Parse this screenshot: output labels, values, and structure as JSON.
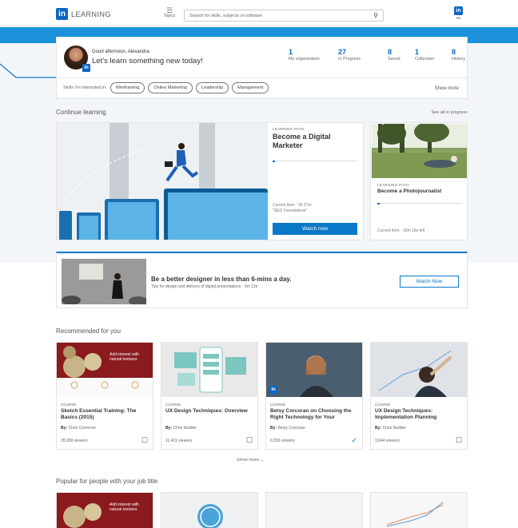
{
  "header": {
    "logo_text": "LEARNING",
    "topics_label": "Topics",
    "search_placeholder": "Search for skills, subjects or software",
    "me_label": "Me"
  },
  "welcome": {
    "greeting": "Good afternoon, Alexandra",
    "tagline": "Let’s learn something new today!",
    "stats": [
      {
        "value": "1",
        "label": "My organization"
      },
      {
        "value": "27",
        "label": "In Progress"
      },
      {
        "value": "8",
        "label": "Saved"
      },
      {
        "value": "1",
        "label": "Collection"
      },
      {
        "value": "8",
        "label": "History"
      }
    ],
    "skills_label": "Skills I’m interested in:",
    "skills": [
      "Wireframing",
      "Online Marketing",
      "Leadership",
      "Management"
    ],
    "show_more": "Show more"
  },
  "continue": {
    "title": "Continue learning",
    "see_all": "See all in progress",
    "main": {
      "type": "LEARNING PATH",
      "title": "Become a Digital Marketer",
      "current_line1": "Current item  ·  3h 27m",
      "current_line2": "\"SEO Foundations\"",
      "button": "Watch now"
    },
    "side": {
      "type": "LEARNING PATH",
      "title": "Become a Photojournalist",
      "current": "Current item  ·  33m 16s left"
    }
  },
  "banner": {
    "title": "Be a better designer in less than 6-mins a day.",
    "subtitle": "Tips for design and delivery of digital presentations  ·  5m 13s",
    "button": "Watch Now"
  },
  "recommended": {
    "title": "Recommended for you",
    "cards": [
      {
        "type": "COURSE",
        "title": "Sketch Essential Training: The Basics (2015)",
        "by_label": "By:",
        "author": "Chris Converse",
        "viewers": "28,999 viewers",
        "icon": "bookmark-icon",
        "thumb_text": "Add interest with natural textures"
      },
      {
        "type": "COURSE",
        "title": "UX Design Techniques: Overview",
        "by_label": "By:",
        "author": "Chris Nodder",
        "viewers": "11,431 viewers",
        "icon": "bookmark-icon"
      },
      {
        "type": "COURSE",
        "title": "Betsy Corcoran on Choosing the Right Technology for Your",
        "by_label": "By:",
        "author": "Betsy Corcoran",
        "viewers": "6,555 viewers",
        "icon": "check-icon"
      },
      {
        "type": "COURSE",
        "title": "UX Design Techniques: Implementation Planning",
        "by_label": "By:",
        "author": "Chris Nodder",
        "viewers": "3,644 viewers",
        "icon": "bookmark-icon"
      }
    ],
    "show_more": "Show more"
  },
  "popular": {
    "title": "Popular for people with your job title",
    "thumb_text": "Add interest with natural textures"
  },
  "colors": {
    "brand": "#0a66c2",
    "accent_bar": "#1a91d9",
    "button": "#0a78c8"
  }
}
